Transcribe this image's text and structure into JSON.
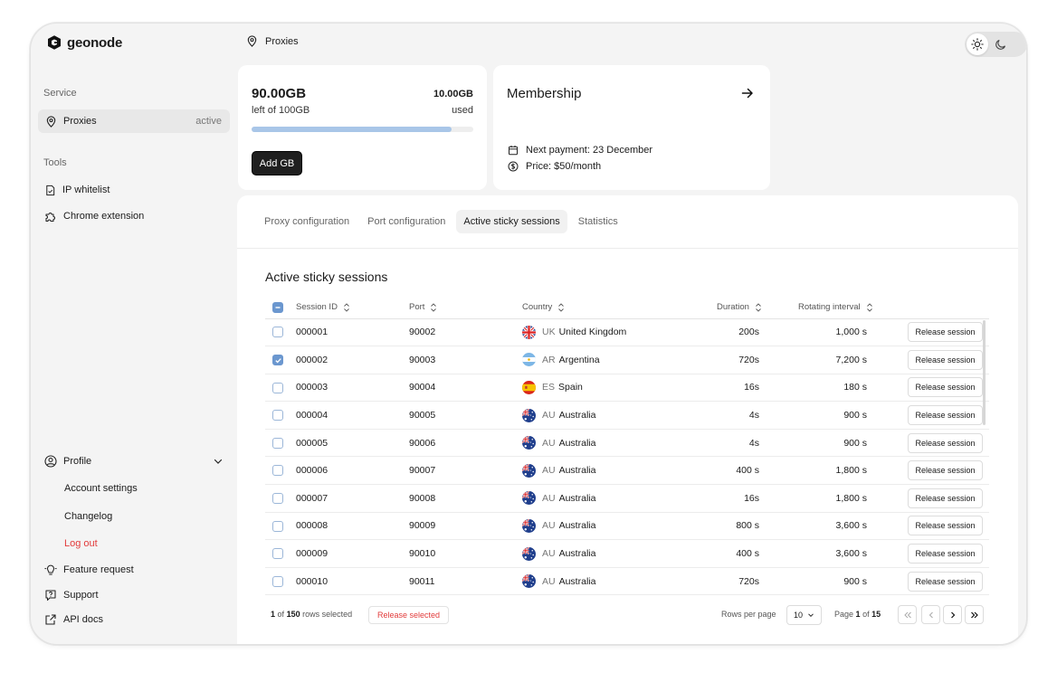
{
  "brand": {
    "name": "geonode"
  },
  "header": {
    "breadcrumb": "Proxies"
  },
  "sidebar": {
    "service_label": "Service",
    "service_items": [
      {
        "label": "Proxies",
        "badge": "active",
        "icon": "location-pin-icon"
      }
    ],
    "tools_label": "Tools",
    "tools_items": [
      {
        "label": "IP whitelist",
        "icon": "document-icon"
      },
      {
        "label": "Chrome extension",
        "icon": "puzzle-icon"
      }
    ],
    "profile": {
      "label": "Profile",
      "items": [
        {
          "label": "Account settings"
        },
        {
          "label": "Changelog"
        },
        {
          "label": "Log out"
        }
      ]
    },
    "bottom_items": [
      {
        "label": "Feature request",
        "icon": "lightbulb-icon"
      },
      {
        "label": "Support",
        "icon": "support-chat-icon"
      },
      {
        "label": "API docs",
        "icon": "external-link-icon"
      }
    ]
  },
  "usage": {
    "left_amount": "90.00GB",
    "left_caption": "left of 100GB",
    "used_amount": "10.00GB",
    "used_caption": "used",
    "progress_fraction": 0.9,
    "add_button": "Add GB"
  },
  "membership": {
    "title": "Membership",
    "next_payment": "Next payment: 23 December",
    "price": "Price: $50/month"
  },
  "tabs": [
    "Proxy configuration",
    "Port configuration",
    "Active sticky sessions",
    "Statistics"
  ],
  "active_tab": "Active sticky sessions",
  "sessions": {
    "title": "Active sticky sessions",
    "columns": [
      "Session ID",
      "Port",
      "Country",
      "Duration",
      "Rotating interval"
    ],
    "rows": [
      {
        "id": "000001",
        "port": "90002",
        "code": "UK",
        "country": "United Kingdom",
        "flag": "uk",
        "duration": "200s",
        "interval": "1,000 s",
        "checked": false,
        "action": "Release session"
      },
      {
        "id": "000002",
        "port": "90003",
        "code": "AR",
        "country": "Argentina",
        "flag": "ar",
        "duration": "720s",
        "interval": "7,200 s",
        "checked": true,
        "action": "Release session"
      },
      {
        "id": "000003",
        "port": "90004",
        "code": "ES",
        "country": "Spain",
        "flag": "es",
        "duration": "16s",
        "interval": "180 s",
        "checked": false,
        "action": "Release session"
      },
      {
        "id": "000004",
        "port": "90005",
        "code": "AU",
        "country": "Australia",
        "flag": "au",
        "duration": "4s",
        "interval": "900 s",
        "checked": false,
        "action": "Release session"
      },
      {
        "id": "000005",
        "port": "90006",
        "code": "AU",
        "country": "Australia",
        "flag": "au",
        "duration": "4s",
        "interval": "900 s",
        "checked": false,
        "action": "Release session"
      },
      {
        "id": "000006",
        "port": "90007",
        "code": "AU",
        "country": "Australia",
        "flag": "au",
        "duration": "400 s",
        "interval": "1,800 s",
        "checked": false,
        "action": "Release session"
      },
      {
        "id": "000007",
        "port": "90008",
        "code": "AU",
        "country": "Australia",
        "flag": "au",
        "duration": "16s",
        "interval": "1,800 s",
        "checked": false,
        "action": "Release session"
      },
      {
        "id": "000008",
        "port": "90009",
        "code": "AU",
        "country": "Australia",
        "flag": "au",
        "duration": "800 s",
        "interval": "3,600 s",
        "checked": false,
        "action": "Release session"
      },
      {
        "id": "000009",
        "port": "90010",
        "code": "AU",
        "country": "Australia",
        "flag": "au",
        "duration": "400 s",
        "interval": "3,600 s",
        "checked": false,
        "action": "Release session"
      },
      {
        "id": "000010",
        "port": "90011",
        "code": "AU",
        "country": "Australia",
        "flag": "au",
        "duration": "720s",
        "interval": "900 s",
        "checked": false,
        "action": "Release session"
      }
    ]
  },
  "footer": {
    "selected": "1",
    "of_word": "of",
    "total_rows": "150",
    "rows_selected_label": "rows selected",
    "release_selected": "Release selected",
    "rows_per_page_label": "Rows per page",
    "rows_per_page": "10",
    "page_word": "Page",
    "page": "1",
    "page_of": "of",
    "total_pages": "15"
  },
  "colors": {
    "accent": "#6b97cf",
    "progress": "#a9c6e8",
    "danger": "#e23b3b"
  }
}
